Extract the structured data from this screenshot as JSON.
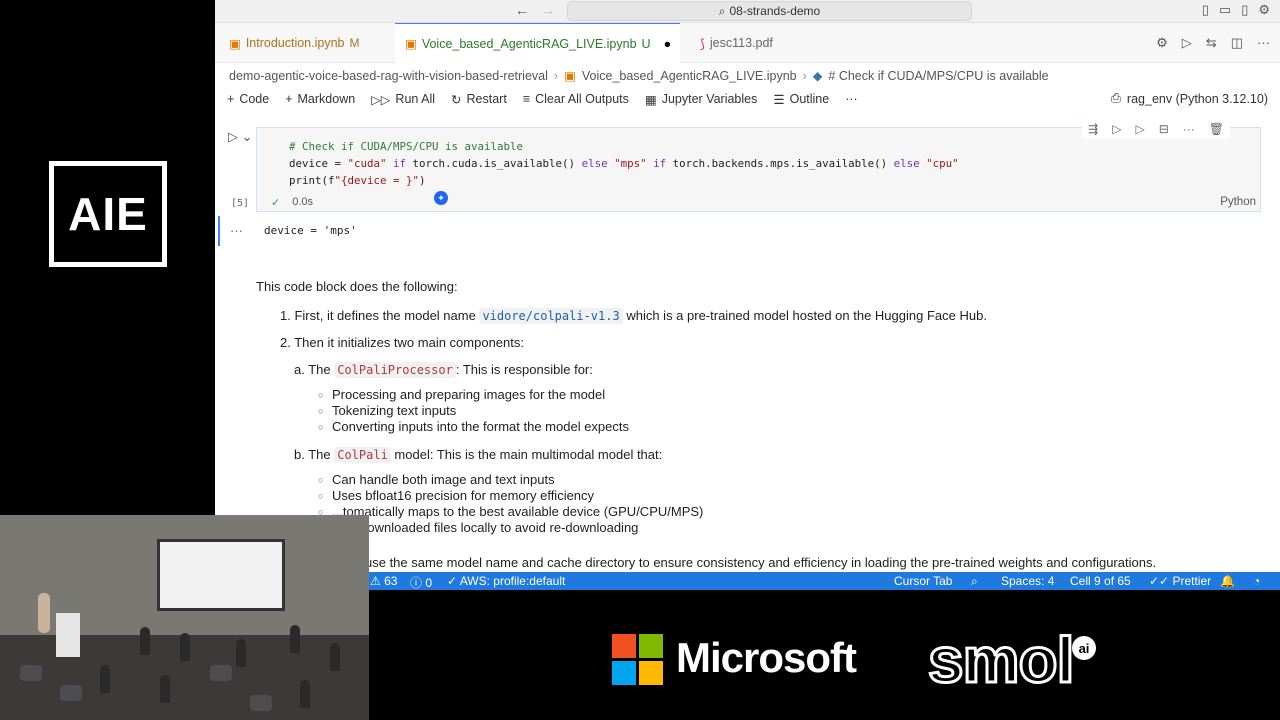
{
  "brand": {
    "aie_logo_text": "AIE",
    "microsoft_text": "Microsoft",
    "smol_text": "smol",
    "smol_badge": "ai"
  },
  "titlebar": {
    "search_text": "08-strands-demo"
  },
  "tabs": [
    {
      "label": "Introduction.ipynb",
      "badge": "M"
    },
    {
      "label": "Voice_based_AgenticRAG_LIVE.ipynb",
      "badge": "U"
    },
    {
      "label": "jesc113.pdf",
      "badge": ""
    }
  ],
  "breadcrumb": {
    "folder": "demo-agentic-voice-based-rag-with-vision-based-retrieval",
    "file": "Voice_based_AgenticRAG_LIVE.ipynb",
    "cell": "# Check if CUDA/MPS/CPU is available"
  },
  "toolbar": {
    "code": "Code",
    "markdown": "Markdown",
    "run_all": "Run All",
    "restart": "Restart",
    "clear_outputs": "Clear All Outputs",
    "variables": "Jupyter Variables",
    "outline": "Outline",
    "more": "···",
    "kernel": "rag_env (Python 3.12.10)"
  },
  "cell": {
    "count": "[5]",
    "line1": "# Check if CUDA/MPS/CPU is available",
    "line2_a": "device = ",
    "line2_b": "\"cuda\"",
    "line2_c": " if ",
    "line2_d": "torch.cuda.is_available() ",
    "line2_e": "else ",
    "line2_f": "\"mps\"",
    "line2_g": " if ",
    "line2_h": "torch.backends.mps.is_available() ",
    "line2_i": "else ",
    "line2_j": "\"cpu\"",
    "line3_a": "print(f",
    "line3_b": "\"{device = }\"",
    "line3_c": ")",
    "exec_time": "0.0s",
    "language": "Python",
    "output": "device = 'mps'"
  },
  "markdown": {
    "intro": "This code block does the following:",
    "item1_prefix": "1. First, it defines the model name ",
    "item1_code": "vidore/colpali-v1.3",
    "item1_suffix": " which is a pre-trained model hosted on the Hugging Face Hub.",
    "item2": "2. Then it initializes two main components:",
    "sub_a_prefix": "a. The ",
    "sub_a_code": "ColPaliProcessor",
    "sub_a_suffix": ": This is responsible for:",
    "sub_a_bullets": [
      "Processing and preparing images for the model",
      "Tokenizing text inputs",
      "Converting inputs into the format the model expects"
    ],
    "sub_b_prefix": "b. The ",
    "sub_b_code": "ColPali",
    "sub_b_suffix": " model: This is the main multimodal model that:",
    "sub_b_bullets": [
      "Can handle both image and text inputs",
      "Uses bfloat16 precision for memory efficiency",
      "...tomatically maps to the best available device (GPU/CPU/MPS)",
      "...es downloaded files locally to avoid re-downloading"
    ],
    "last_line": "use the same model name and cache directory to ensure consistency and efficiency in loading the pre-trained weights and configurations."
  },
  "statusbar": {
    "errors": "63",
    "warnings": "0",
    "aws": "AWS: profile:default",
    "cursor_tab": "Cursor Tab",
    "spaces": "Spaces: 4",
    "cell_pos": "Cell 9 of 65",
    "prettier": "Prettier"
  }
}
